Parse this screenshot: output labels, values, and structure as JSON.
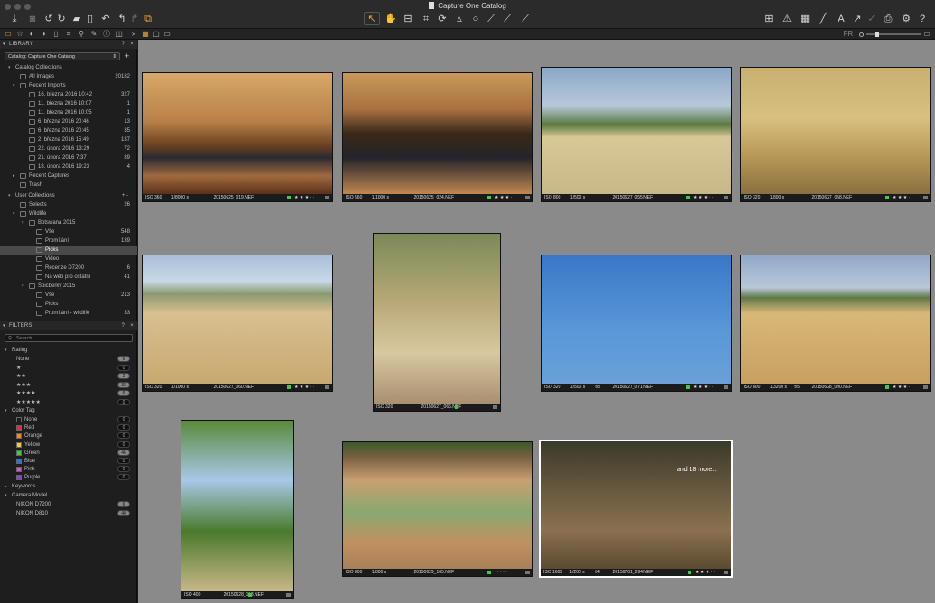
{
  "window": {
    "title": "Capture One Catalog"
  },
  "toolbar": {
    "icons": [
      "import-icon",
      "camera-icon",
      "rotate-left-icon",
      "rotate-right-icon",
      "folder-move-icon",
      "trash-icon",
      "undo-icon",
      "undo-arrow-icon",
      "redo-icon",
      "overlay-icon",
      "pointer-tool-icon",
      "pan-tool-icon",
      "loupe-tool-icon",
      "crop-tool-icon",
      "rotate-tool-icon",
      "circle-tool-icon",
      "brush-tool-icon",
      "picker-tool-icon",
      "eraser-tool-icon",
      "grid-icon",
      "warning-icon",
      "histogram-icon",
      "brush-icon",
      "text-icon",
      "copy-icon",
      "apply-icon",
      "print-icon",
      "gear-icon",
      "help-icon"
    ],
    "fr_label": "FR"
  },
  "library": {
    "header": "LIBRARY",
    "catalog_select": "Catalog: Capture One Catalog",
    "catalog_collections": "Catalog Collections",
    "all_images": {
      "label": "All Images",
      "count": "20182"
    },
    "recent_imports": {
      "label": "Recent Imports",
      "items": [
        {
          "label": "16. března 2016 10:42",
          "count": "327"
        },
        {
          "label": "11. března 2016 10:07",
          "count": "1"
        },
        {
          "label": "11. března 2016 10:05",
          "count": "1"
        },
        {
          "label": "6. března 2016 20:46",
          "count": "13"
        },
        {
          "label": "6. března 2016 20:45",
          "count": "35"
        },
        {
          "label": "2. března 2016 15:49",
          "count": "137"
        },
        {
          "label": "22. února 2016 13:29",
          "count": "72"
        },
        {
          "label": "21. února 2016 7:37",
          "count": "89"
        },
        {
          "label": "18. února 2016 19:23",
          "count": "4"
        }
      ]
    },
    "recent_captures": "Recent Captures",
    "trash": "Trash",
    "user_collections": "User Collections",
    "selects": {
      "label": "Selects",
      "count": "26"
    },
    "wildlife": "Wildlife",
    "botswana": {
      "label": "Botswana 2015",
      "items": [
        {
          "label": "Vše",
          "count": "548"
        },
        {
          "label": "Promítání",
          "count": "139"
        },
        {
          "label": "Picks",
          "count": ""
        },
        {
          "label": "Video",
          "count": ""
        },
        {
          "label": "Recenze D7200",
          "count": "6"
        },
        {
          "label": "Na web pro ostatní",
          "count": "41"
        }
      ]
    },
    "spicberky": {
      "label": "Špicberky 2015",
      "items": [
        {
          "label": "Vše",
          "count": "213"
        },
        {
          "label": "Picks",
          "count": ""
        },
        {
          "label": "Promítání - wildlife",
          "count": "33"
        }
      ]
    }
  },
  "filters": {
    "header": "FILTERS",
    "search_placeholder": "Search",
    "rating": {
      "label": "Rating",
      "items": [
        {
          "label": "None",
          "count": "6"
        },
        {
          "label": "★",
          "count": "0"
        },
        {
          "label": "★★",
          "count": "2"
        },
        {
          "label": "★★★",
          "count": "32"
        },
        {
          "label": "★★★★",
          "count": "6"
        },
        {
          "label": "★★★★★",
          "count": "0"
        }
      ]
    },
    "color_tag": {
      "label": "Color Tag",
      "items": [
        {
          "label": "None",
          "count": "0",
          "color": "#1e1e1e"
        },
        {
          "label": "Red",
          "count": "0",
          "color": "#e03030"
        },
        {
          "label": "Orange",
          "count": "0",
          "color": "#f08a20"
        },
        {
          "label": "Yellow",
          "count": "0",
          "color": "#e8d030"
        },
        {
          "label": "Green",
          "count": "46",
          "color": "#3ccf3c"
        },
        {
          "label": "Blue",
          "count": "0",
          "color": "#3070e8"
        },
        {
          "label": "Pink",
          "count": "0",
          "color": "#e050c8"
        },
        {
          "label": "Purple",
          "count": "0",
          "color": "#9040e0"
        }
      ]
    },
    "keywords": "Keywords",
    "camera_model": {
      "label": "Camera Model",
      "items": [
        {
          "label": "NIKON D7200",
          "count": "6"
        },
        {
          "label": "NIKON D810",
          "count": "40"
        }
      ]
    }
  },
  "browser": {
    "more_label": "and 18 more...",
    "tiles": [
      {
        "iso": "ISO 360",
        "shutter": "1/8000 s",
        "aperture": "",
        "file": "20150625_019.NEF",
        "stars": "★ ★ ★ · ·"
      },
      {
        "iso": "ISO 560",
        "shutter": "1/1000 s",
        "aperture": "",
        "file": "20150625_024.NEF",
        "stars": "★ ★ ★ · ·"
      },
      {
        "iso": "ISO 800",
        "shutter": "1/500 s",
        "aperture": "",
        "file": "20150627_055.NEF",
        "stars": "★ ★ ★ · ·"
      },
      {
        "iso": "ISO 320",
        "shutter": "1/800 s",
        "aperture": "",
        "file": "20150627_058.NEF",
        "stars": "★ ★ ★ · ·"
      },
      {
        "iso": "ISO 320",
        "shutter": "1/1000 s",
        "aperture": "",
        "file": "20150627_060.NEF",
        "stars": "★ ★ ★ · ·"
      },
      {
        "iso": "ISO 320",
        "shutter": "",
        "aperture": "",
        "file": "20150627_066.NEF",
        "stars": ""
      },
      {
        "iso": "ISO 320",
        "shutter": "1/500 s",
        "aperture": "f/8",
        "file": "20150627_071.NEF",
        "stars": "★ ★ ★ · ·"
      },
      {
        "iso": "ISO 800",
        "shutter": "1/3200 s",
        "aperture": "f/5",
        "file": "20150628_090.NEF",
        "stars": "★ ★ ★ · ·"
      },
      {
        "iso": "ISO 400",
        "shutter": "",
        "aperture": "",
        "file": "20150628_113.NEF",
        "stars": ""
      },
      {
        "iso": "ISO 800",
        "shutter": "1/800 s",
        "aperture": "",
        "file": "20150629_165.NEF",
        "stars": "· · · · ·"
      },
      {
        "iso": "ISO 1600",
        "shutter": "1/200 s",
        "aperture": "f/4",
        "file": "20150701_294.NEF",
        "stars": "★ ★ ★ · ·"
      }
    ]
  }
}
